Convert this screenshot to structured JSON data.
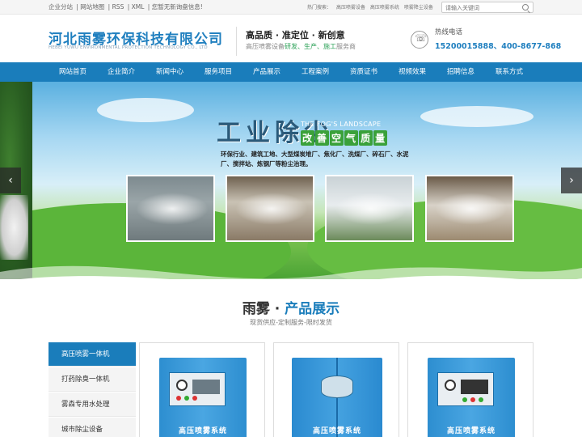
{
  "topbar": {
    "links": [
      "企业分站",
      "网站地图",
      "RSS",
      "XML",
      "您暂无新询盘信息!"
    ],
    "hot_label": "热门搜索：",
    "hot_items": [
      "高压喷雾设备",
      "高压喷雾系统",
      "喷雾降尘设备"
    ],
    "search_placeholder": "请输入关键词"
  },
  "header": {
    "logo_cn": "河北雨雾环保科技有限公司",
    "logo_en": "HEBEI YUWU ENVIRONMENTAL PROTECTION TECHNOLOGY CO., LTD",
    "slogan": "高品质 · 准定位 · 新创意",
    "slogan_sub_1": "高压喷雾设备",
    "slogan_sub_hl": "研发、生产、施工",
    "slogan_sub_2": "服务商",
    "hotline_label": "热线电话",
    "hotline_number": "15200015888、400-8677-868"
  },
  "nav": {
    "items": [
      "网站首页",
      "企业简介",
      "新闻中心",
      "服务项目",
      "产品展示",
      "工程案例",
      "资质证书",
      "视频效果",
      "招聘信息",
      "联系方式"
    ]
  },
  "banner": {
    "title": "工业除尘",
    "subtitle_en": "THE FOG'S LANDSCAPE",
    "tag": [
      "改",
      "善",
      "空",
      "气",
      "质",
      "量"
    ],
    "description": "环保行业、建筑工地、大型煤炭堆厂、焦化厂、洗煤厂、碎石厂、水泥厂、搅拌站、炼钢厂等粉尘治理。",
    "prev": "‹",
    "next": "›"
  },
  "products": {
    "title_a": "雨雾 · ",
    "title_b": "产品展示",
    "subtitle": "现货供应-定制服务-限时发货",
    "categories": [
      "高压喷雾一体机",
      "打药除臭一体机",
      "雾森专用水处理",
      "城市除尘设备"
    ],
    "cards": [
      {
        "label": "高压喷雾系统"
      },
      {
        "label": "高压喷雾系统"
      },
      {
        "label": "高压喷雾系统"
      }
    ]
  },
  "colors": {
    "brand_blue": "#1a7dbb",
    "accent_green": "#2fa35a"
  },
  "icons": {
    "search": "search-icon",
    "phone": "phone-icon",
    "prev": "chevron-left-icon",
    "next": "chevron-right-icon"
  }
}
